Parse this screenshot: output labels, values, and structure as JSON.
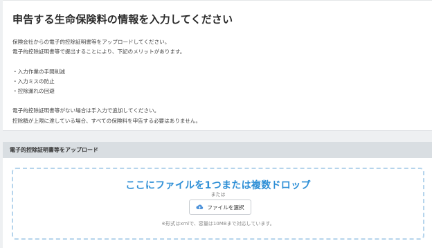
{
  "page": {
    "title": "申告する生命保険料の情報を入力してください",
    "description": {
      "line1": "保険会社からの電子的控除証明書等をアップロードしてください。",
      "line2": "電子的控除証明書等で提出することにより、下記のメリットがあります。",
      "benefits": [
        "・入力作業の手間削減",
        "・入力ミスの防止",
        "・控除漏れの回避"
      ],
      "line3": "電子的控除証明書等がない場合は手入力で追加してください。",
      "line4": "控除額が上限に達している場合、すべての保険料を申告する必要はありません。"
    }
  },
  "upload": {
    "header": "電子的控除証明書等をアップロード",
    "drop_text": "ここにファイルを1つまたは複数ドロップ",
    "or_text": "または",
    "button_label": "ファイルを選択",
    "button_icon": "cloud-upload-icon",
    "note": "※形式はxmlで、容量は10MBまで対応しています。"
  },
  "colors": {
    "accent": "#2e8fd6",
    "drop_border": "#b5d4ec",
    "header_bg": "#d9dee2",
    "page_bg": "#eef0f2"
  }
}
